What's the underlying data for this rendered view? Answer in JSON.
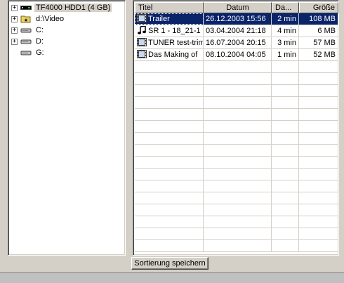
{
  "tree": {
    "items": [
      {
        "label": "TF4000 HDD1 (4 GB)",
        "icon": "receiver-device-icon",
        "expander": "+",
        "selected": true
      },
      {
        "label": "d:\\Video",
        "icon": "folder-icon",
        "expander": "+"
      },
      {
        "label": "C:",
        "icon": "drive-icon",
        "expander": "+"
      },
      {
        "label": "D:",
        "icon": "drive-icon",
        "expander": "+"
      },
      {
        "label": "G:",
        "icon": "drive-icon",
        "expander": ""
      }
    ]
  },
  "list": {
    "columns": [
      "Titel",
      "Datum",
      "Da...",
      "Größe"
    ],
    "rows": [
      {
        "title": "Trailer",
        "date": "26.12.2003 15:56",
        "duration": "2 min",
        "size": "108 MB",
        "icon": "film-icon",
        "selected": true
      },
      {
        "title": "SR 1 - 18_21-1",
        "date": "03.04.2004 21:18",
        "duration": "4 min",
        "size": "6 MB",
        "icon": "music-note-icon"
      },
      {
        "title": "TUNER test-trim",
        "date": "16.07.2004 20:15",
        "duration": "3 min",
        "size": "57 MB",
        "icon": "film-icon"
      },
      {
        "title": "Das Making of",
        "date": "08.10.2004 04:05",
        "duration": "1 min",
        "size": "52 MB",
        "icon": "film-icon"
      }
    ]
  },
  "actions": {
    "save_sort": "Sortierung speichern"
  },
  "colors": {
    "selection": "#0a246a",
    "face": "#d4d0c8"
  }
}
